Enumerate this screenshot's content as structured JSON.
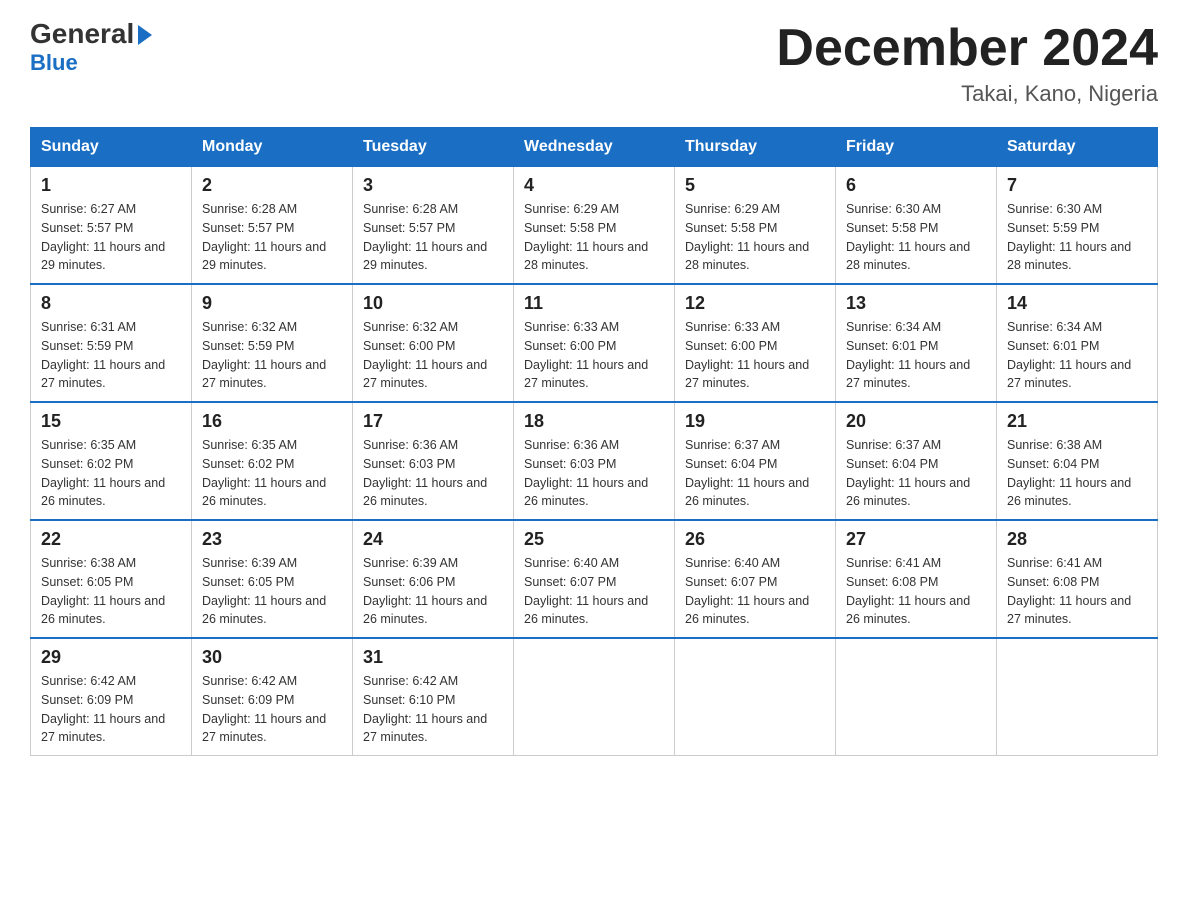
{
  "logo": {
    "general": "General",
    "blue": "Blue",
    "arrow": "▶"
  },
  "title": "December 2024",
  "location": "Takai, Kano, Nigeria",
  "days_header": [
    "Sunday",
    "Monday",
    "Tuesday",
    "Wednesday",
    "Thursday",
    "Friday",
    "Saturday"
  ],
  "weeks": [
    [
      {
        "day": "1",
        "sunrise": "6:27 AM",
        "sunset": "5:57 PM",
        "daylight": "11 hours and 29 minutes."
      },
      {
        "day": "2",
        "sunrise": "6:28 AM",
        "sunset": "5:57 PM",
        "daylight": "11 hours and 29 minutes."
      },
      {
        "day": "3",
        "sunrise": "6:28 AM",
        "sunset": "5:57 PM",
        "daylight": "11 hours and 29 minutes."
      },
      {
        "day": "4",
        "sunrise": "6:29 AM",
        "sunset": "5:58 PM",
        "daylight": "11 hours and 28 minutes."
      },
      {
        "day": "5",
        "sunrise": "6:29 AM",
        "sunset": "5:58 PM",
        "daylight": "11 hours and 28 minutes."
      },
      {
        "day": "6",
        "sunrise": "6:30 AM",
        "sunset": "5:58 PM",
        "daylight": "11 hours and 28 minutes."
      },
      {
        "day": "7",
        "sunrise": "6:30 AM",
        "sunset": "5:59 PM",
        "daylight": "11 hours and 28 minutes."
      }
    ],
    [
      {
        "day": "8",
        "sunrise": "6:31 AM",
        "sunset": "5:59 PM",
        "daylight": "11 hours and 27 minutes."
      },
      {
        "day": "9",
        "sunrise": "6:32 AM",
        "sunset": "5:59 PM",
        "daylight": "11 hours and 27 minutes."
      },
      {
        "day": "10",
        "sunrise": "6:32 AM",
        "sunset": "6:00 PM",
        "daylight": "11 hours and 27 minutes."
      },
      {
        "day": "11",
        "sunrise": "6:33 AM",
        "sunset": "6:00 PM",
        "daylight": "11 hours and 27 minutes."
      },
      {
        "day": "12",
        "sunrise": "6:33 AM",
        "sunset": "6:00 PM",
        "daylight": "11 hours and 27 minutes."
      },
      {
        "day": "13",
        "sunrise": "6:34 AM",
        "sunset": "6:01 PM",
        "daylight": "11 hours and 27 minutes."
      },
      {
        "day": "14",
        "sunrise": "6:34 AM",
        "sunset": "6:01 PM",
        "daylight": "11 hours and 27 minutes."
      }
    ],
    [
      {
        "day": "15",
        "sunrise": "6:35 AM",
        "sunset": "6:02 PM",
        "daylight": "11 hours and 26 minutes."
      },
      {
        "day": "16",
        "sunrise": "6:35 AM",
        "sunset": "6:02 PM",
        "daylight": "11 hours and 26 minutes."
      },
      {
        "day": "17",
        "sunrise": "6:36 AM",
        "sunset": "6:03 PM",
        "daylight": "11 hours and 26 minutes."
      },
      {
        "day": "18",
        "sunrise": "6:36 AM",
        "sunset": "6:03 PM",
        "daylight": "11 hours and 26 minutes."
      },
      {
        "day": "19",
        "sunrise": "6:37 AM",
        "sunset": "6:04 PM",
        "daylight": "11 hours and 26 minutes."
      },
      {
        "day": "20",
        "sunrise": "6:37 AM",
        "sunset": "6:04 PM",
        "daylight": "11 hours and 26 minutes."
      },
      {
        "day": "21",
        "sunrise": "6:38 AM",
        "sunset": "6:04 PM",
        "daylight": "11 hours and 26 minutes."
      }
    ],
    [
      {
        "day": "22",
        "sunrise": "6:38 AM",
        "sunset": "6:05 PM",
        "daylight": "11 hours and 26 minutes."
      },
      {
        "day": "23",
        "sunrise": "6:39 AM",
        "sunset": "6:05 PM",
        "daylight": "11 hours and 26 minutes."
      },
      {
        "day": "24",
        "sunrise": "6:39 AM",
        "sunset": "6:06 PM",
        "daylight": "11 hours and 26 minutes."
      },
      {
        "day": "25",
        "sunrise": "6:40 AM",
        "sunset": "6:07 PM",
        "daylight": "11 hours and 26 minutes."
      },
      {
        "day": "26",
        "sunrise": "6:40 AM",
        "sunset": "6:07 PM",
        "daylight": "11 hours and 26 minutes."
      },
      {
        "day": "27",
        "sunrise": "6:41 AM",
        "sunset": "6:08 PM",
        "daylight": "11 hours and 26 minutes."
      },
      {
        "day": "28",
        "sunrise": "6:41 AM",
        "sunset": "6:08 PM",
        "daylight": "11 hours and 27 minutes."
      }
    ],
    [
      {
        "day": "29",
        "sunrise": "6:42 AM",
        "sunset": "6:09 PM",
        "daylight": "11 hours and 27 minutes."
      },
      {
        "day": "30",
        "sunrise": "6:42 AM",
        "sunset": "6:09 PM",
        "daylight": "11 hours and 27 minutes."
      },
      {
        "day": "31",
        "sunrise": "6:42 AM",
        "sunset": "6:10 PM",
        "daylight": "11 hours and 27 minutes."
      },
      null,
      null,
      null,
      null
    ]
  ]
}
